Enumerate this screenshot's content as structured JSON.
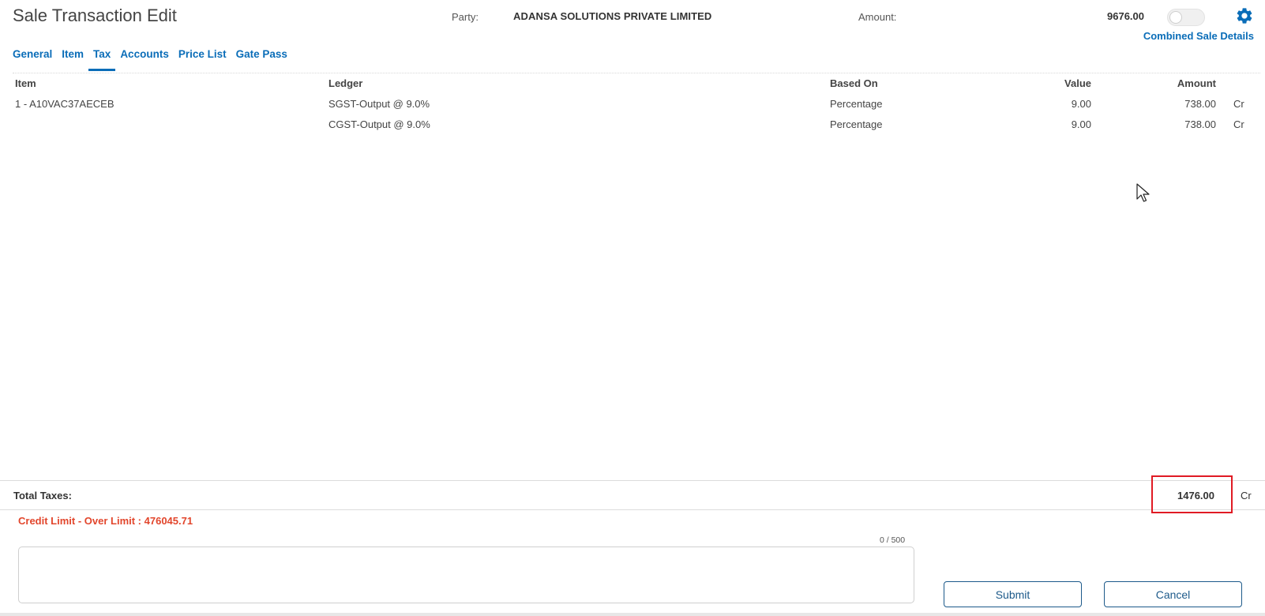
{
  "header": {
    "title": "Sale Transaction Edit",
    "party_label": "Party:",
    "party_value": "ADANSA SOLUTIONS PRIVATE LIMITED",
    "amount_label": "Amount:",
    "amount_value": "9676.00",
    "settings_icon": "gear-icon",
    "combined_link": "Combined Sale Details"
  },
  "tabs": [
    {
      "label": "General",
      "active": false
    },
    {
      "label": "Item",
      "active": false
    },
    {
      "label": "Tax",
      "active": true
    },
    {
      "label": "Accounts",
      "active": false
    },
    {
      "label": "Price List",
      "active": false
    },
    {
      "label": "Gate Pass",
      "active": false
    }
  ],
  "table": {
    "headers": {
      "item": "Item",
      "ledger": "Ledger",
      "based_on": "Based On",
      "value": "Value",
      "amount": "Amount"
    },
    "rows": [
      {
        "item": "1 - A10VAC37AECEB",
        "ledger": "SGST-Output @ 9.0%",
        "based_on": "Percentage",
        "value": "9.00",
        "amount": "738.00",
        "drcr": "Cr"
      },
      {
        "item": "",
        "ledger": "CGST-Output @ 9.0%",
        "based_on": "Percentage",
        "value": "9.00",
        "amount": "738.00",
        "drcr": "Cr"
      }
    ]
  },
  "totals": {
    "label": "Total Taxes:",
    "value": "1476.00",
    "drcr": "Cr"
  },
  "footer": {
    "credit_warning": "Credit Limit - Over Limit : 476045.71",
    "char_counter": "0 / 500",
    "remarks_value": "",
    "submit_label": "Submit",
    "cancel_label": "Cancel"
  },
  "colors": {
    "accent": "#0a6db8",
    "warning": "#e2462c",
    "highlight": "#e01b24",
    "button_border": "#1d5a8a"
  }
}
